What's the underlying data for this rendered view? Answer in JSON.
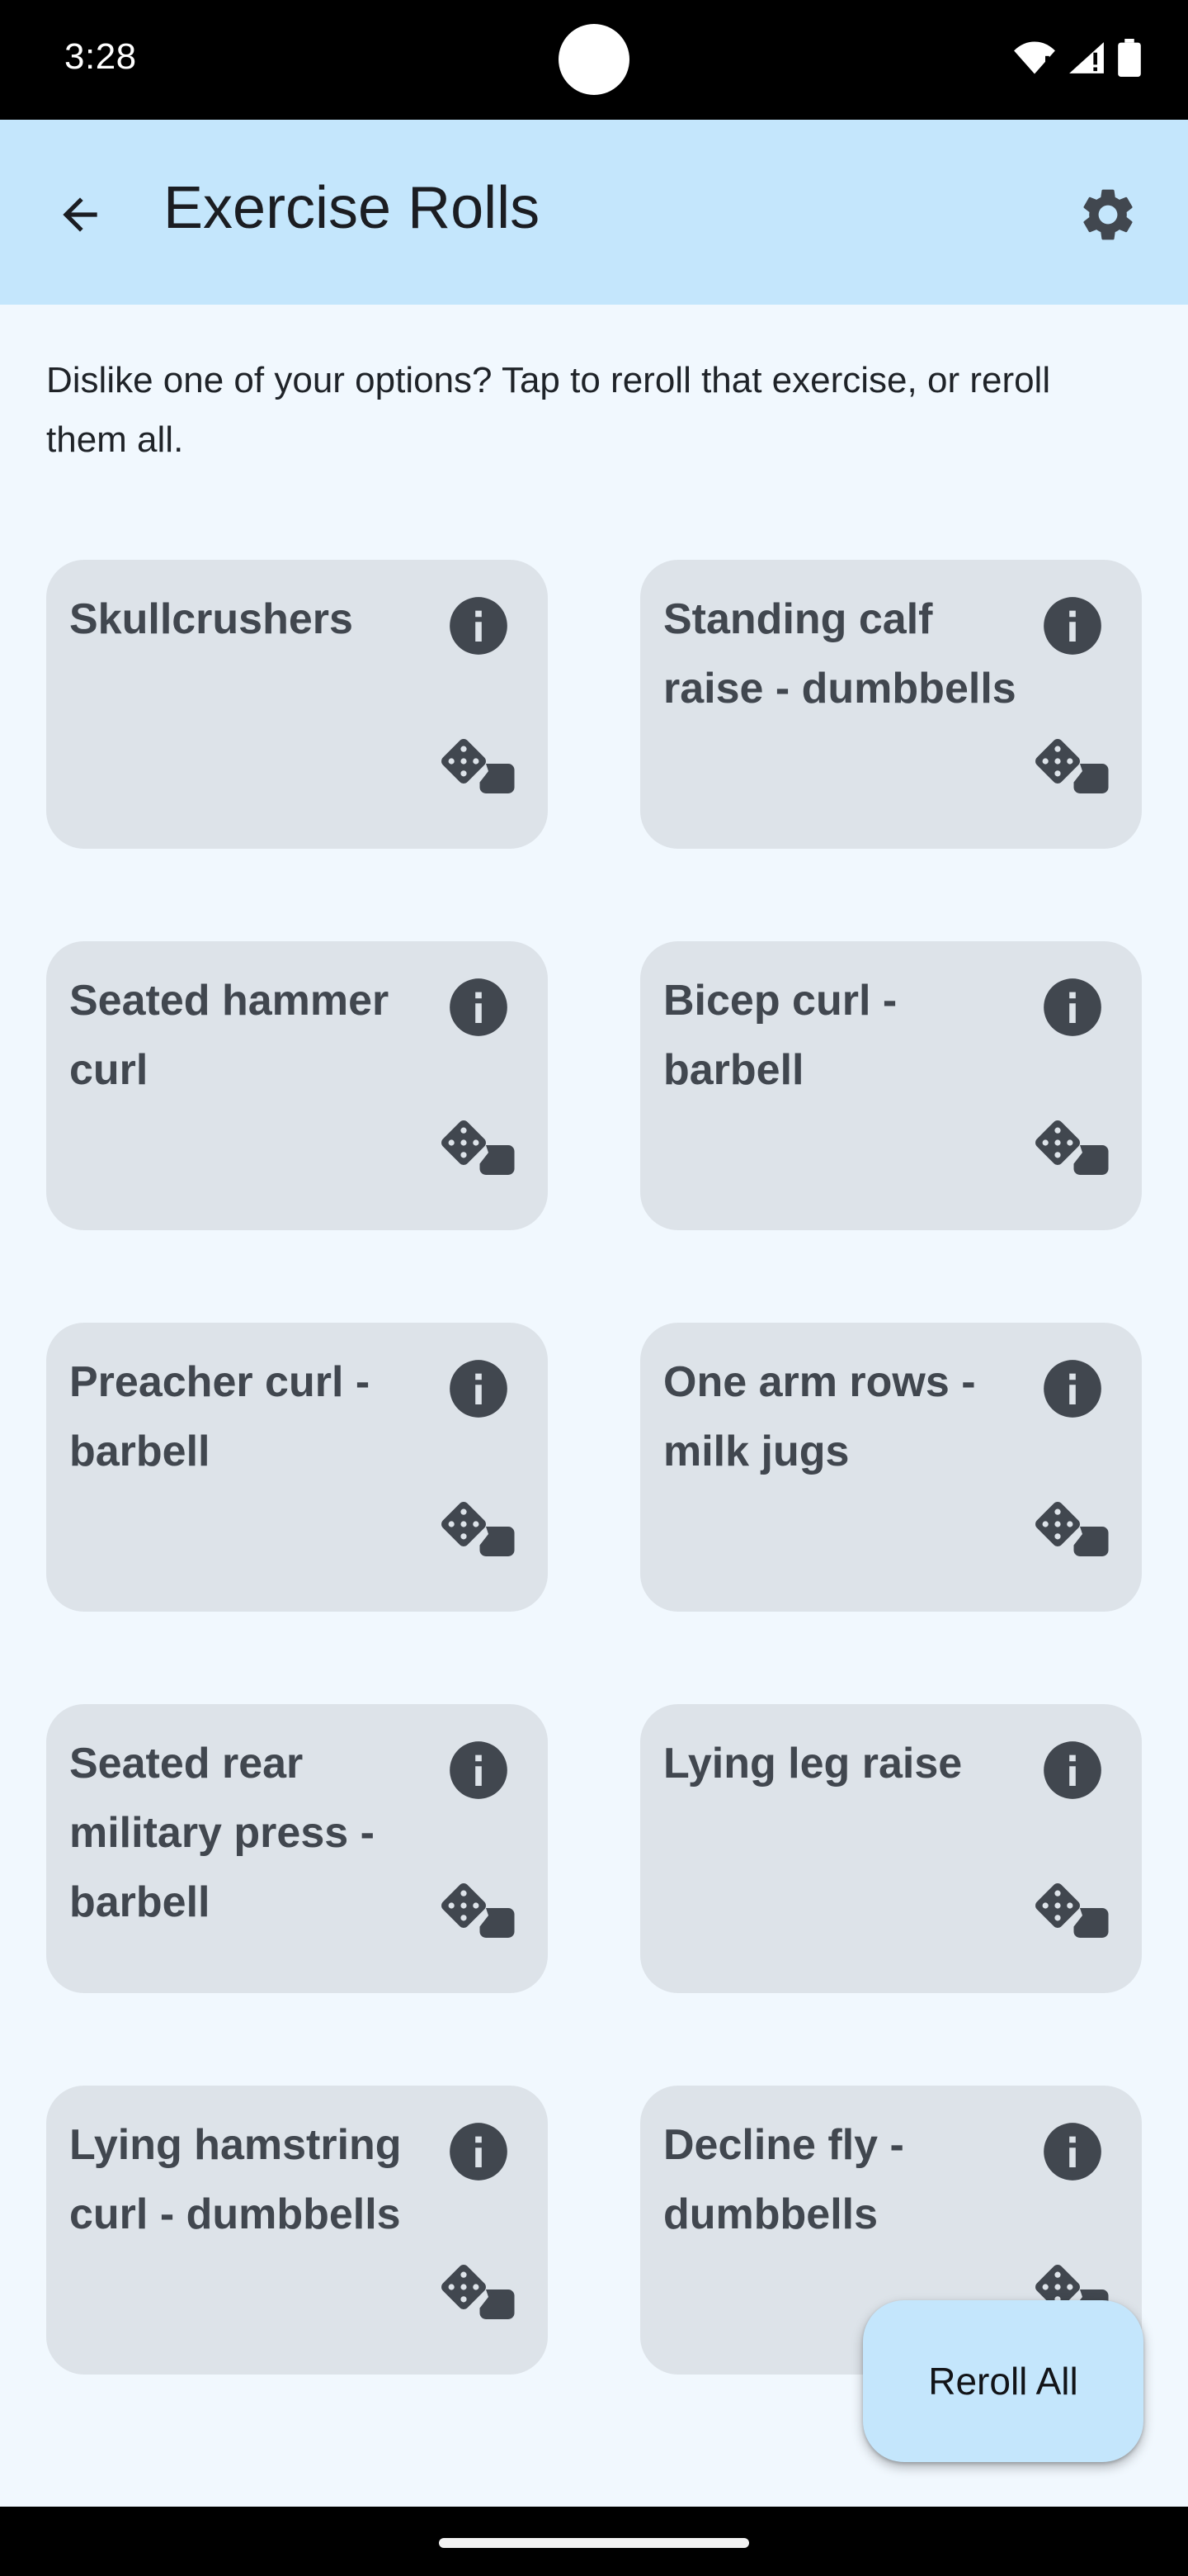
{
  "status": {
    "time": "3:28"
  },
  "appbar": {
    "title": "Exercise Rolls",
    "back_icon": "arrow-back-icon",
    "settings_icon": "gear-icon"
  },
  "intro_text": "Dislike one of your options? Tap to reroll that exercise, or reroll them all.",
  "cards": [
    {
      "title": "Skullcrushers"
    },
    {
      "title": "Standing calf raise - dumbbells"
    },
    {
      "title": "Seated hammer curl"
    },
    {
      "title": "Bicep curl - barbell"
    },
    {
      "title": "Preacher curl - barbell"
    },
    {
      "title": "One arm rows - milk jugs"
    },
    {
      "title": "Seated rear military press - barbell"
    },
    {
      "title": "Lying leg raise"
    },
    {
      "title": "Lying hamstring curl - dumbbells"
    },
    {
      "title": "Decline fly - dumbbells"
    }
  ],
  "fab": {
    "label": "Reroll All"
  },
  "colors": {
    "app_bar": "#c4e6fc",
    "background": "#f1f8fe",
    "card": "#dde3e9",
    "icon": "#41474f"
  }
}
